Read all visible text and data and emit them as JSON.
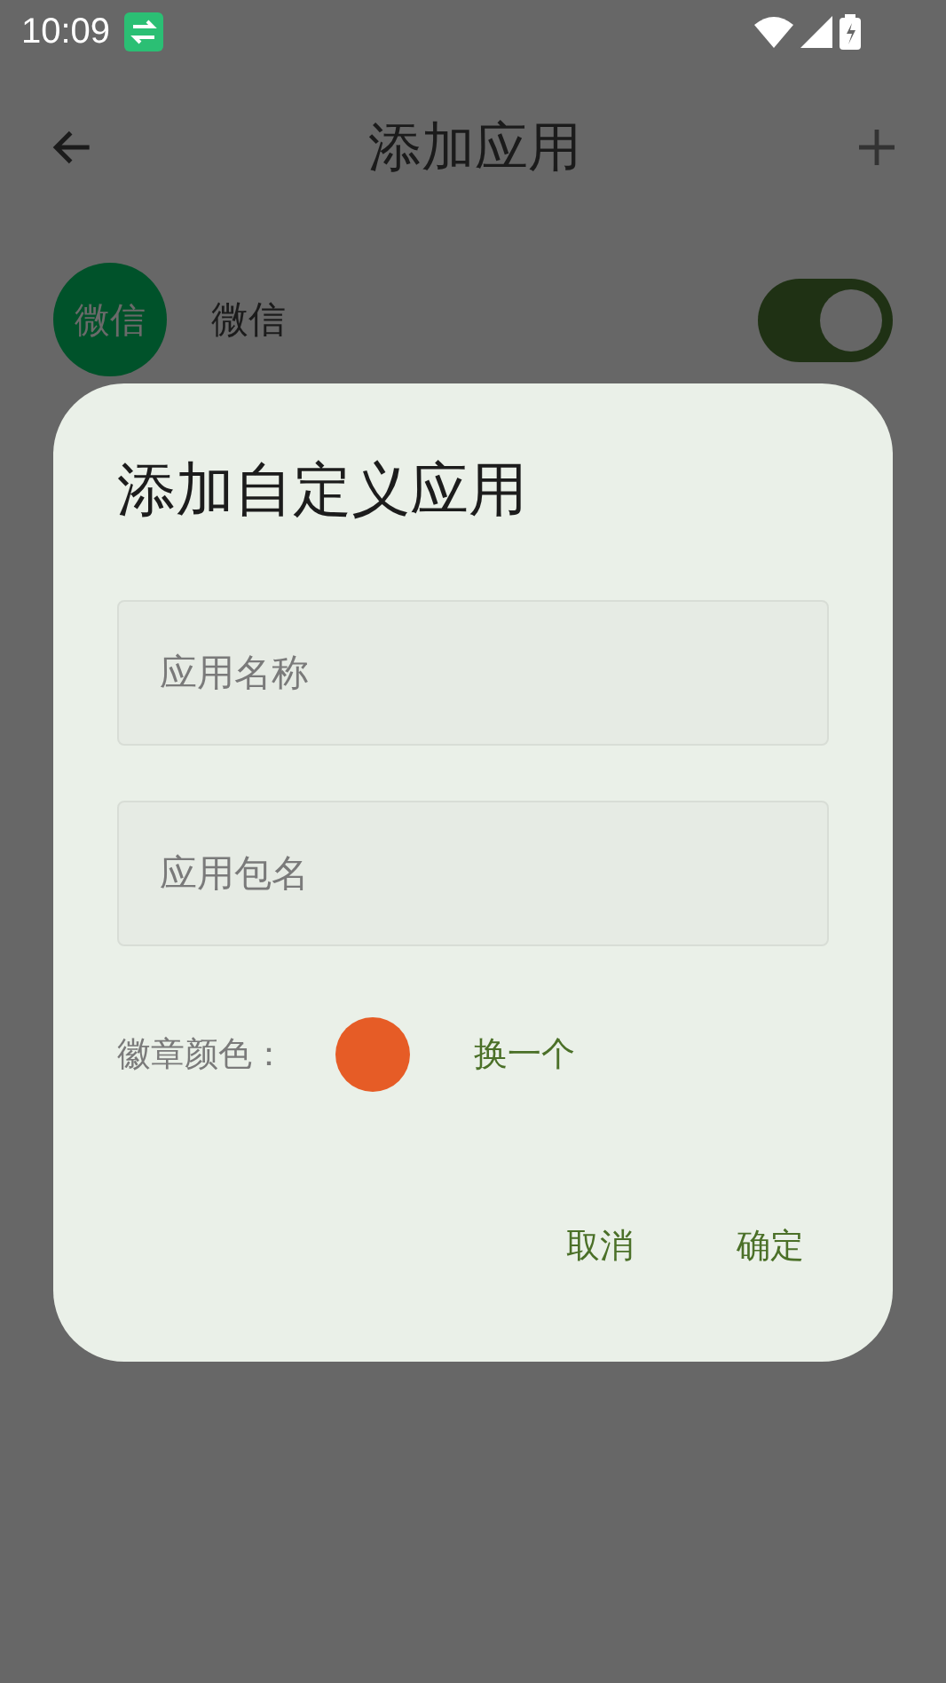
{
  "status_bar": {
    "time": "10:09"
  },
  "toolbar": {
    "title": "添加应用"
  },
  "apps": [
    {
      "name": "微信",
      "badge_text": "微信",
      "color": "#00522a",
      "on": true
    }
  ],
  "dialog": {
    "title": "添加自定义应用",
    "fields": [
      {
        "placeholder": "应用名称"
      },
      {
        "placeholder": "应用包名"
      }
    ],
    "badge": {
      "label": "徽章颜色：",
      "color": "#e65c26",
      "action": "换一个"
    },
    "buttons": [
      "取消",
      "确定"
    ]
  }
}
